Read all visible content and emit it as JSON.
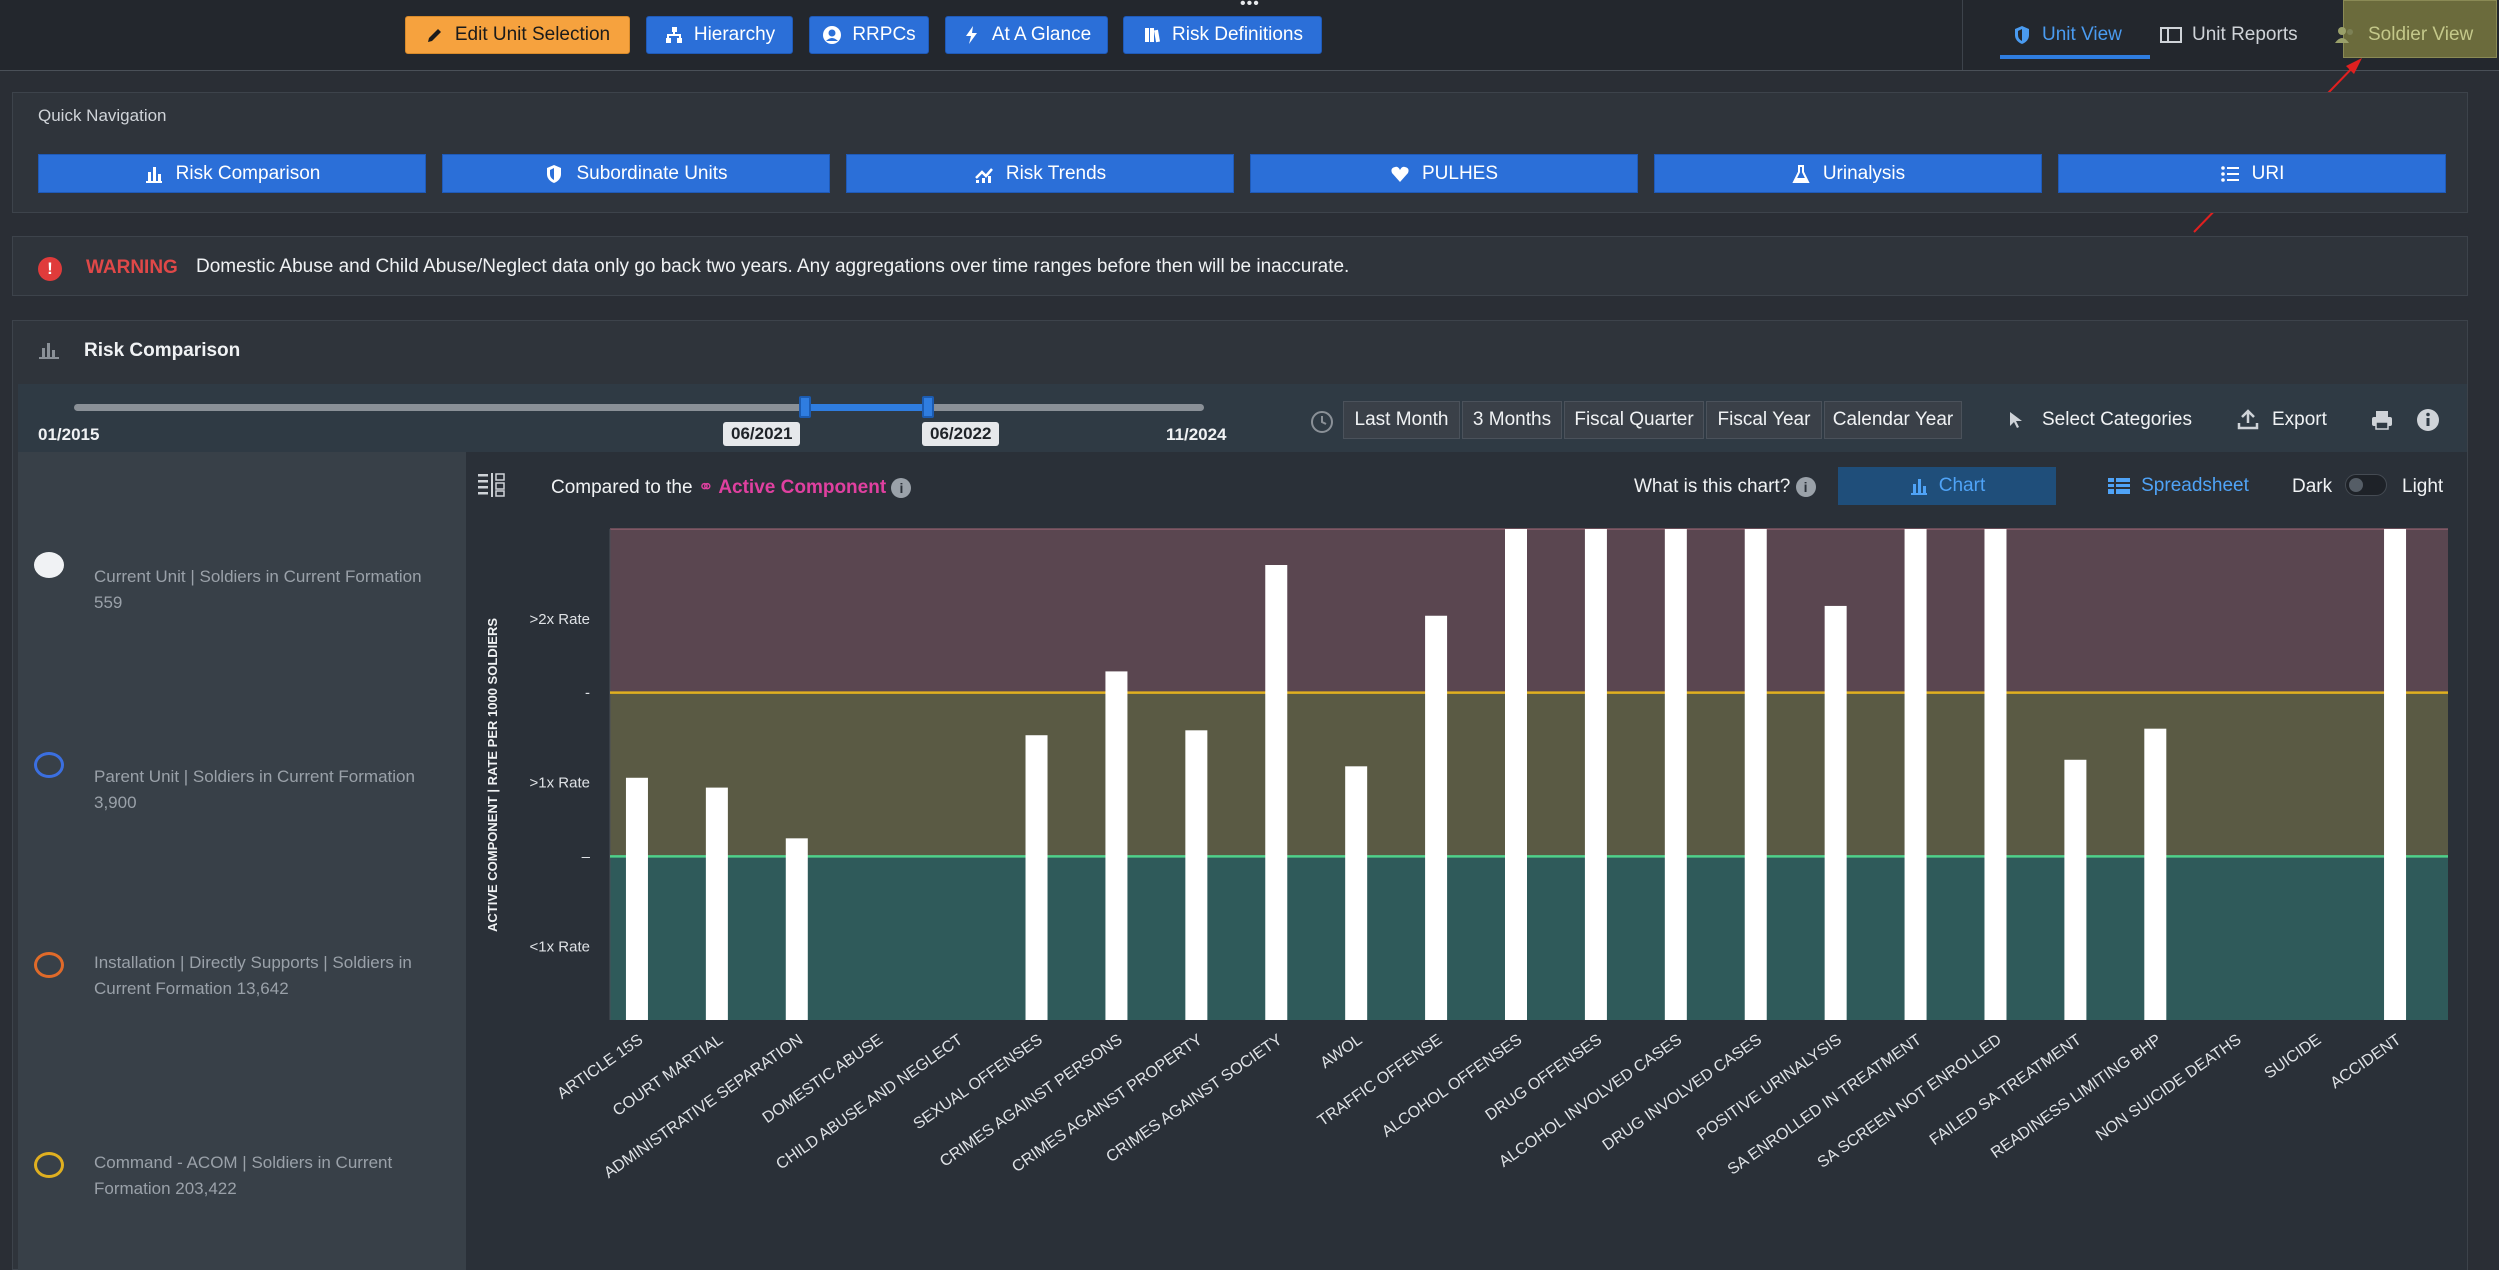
{
  "toolbar": {
    "buttons": [
      {
        "label": "Edit Unit Selection",
        "icon": "pencil-icon"
      },
      {
        "label": "Hierarchy",
        "icon": "hierarchy-icon"
      },
      {
        "label": "RRPCs",
        "icon": "user-circle-icon"
      },
      {
        "label": "At A Glance",
        "icon": "bolt-icon"
      },
      {
        "label": "Risk Definitions",
        "icon": "book-icon"
      }
    ],
    "views": [
      {
        "label": "Unit View",
        "icon": "shield-icon",
        "active": true
      },
      {
        "label": "Unit Reports",
        "icon": "report-icon",
        "active": false
      },
      {
        "label": "Soldier View",
        "icon": "soldiers-icon",
        "active": false
      }
    ]
  },
  "quick_nav": {
    "title": "Quick Navigation",
    "buttons": [
      {
        "label": "Risk Comparison",
        "icon": "bar-chart-icon"
      },
      {
        "label": "Subordinate Units",
        "icon": "shield-icon"
      },
      {
        "label": "Risk Trends",
        "icon": "trend-icon"
      },
      {
        "label": "PULHES",
        "icon": "heart-icon"
      },
      {
        "label": "Urinalysis",
        "icon": "flask-icon"
      },
      {
        "label": "URI",
        "icon": "list-icon"
      }
    ]
  },
  "warning": {
    "label": "WARNING",
    "text": "Domestic Abuse and Child Abuse/Neglect data only go back two years. Any aggregations over time ranges before then will be inaccurate."
  },
  "risk_comparison": {
    "title": "Risk Comparison",
    "date_range": {
      "start": "01/2015",
      "end": "11/2024",
      "selected_from": "06/2021",
      "selected_to": "06/2022",
      "selected_from_fraction": 0.64,
      "selected_to_fraction": 0.75
    },
    "range_buttons": [
      "Last Month",
      "3 Months",
      "Fiscal Quarter",
      "Fiscal Year",
      "Calendar Year"
    ],
    "tools": {
      "select_categories": "Select Categories",
      "export": "Export"
    },
    "compared_to_prefix": "Compared to the",
    "compared_to_value": "Active Component",
    "what_is_chart": "What is this chart?",
    "tabs": {
      "chart": "Chart",
      "spreadsheet": "Spreadsheet"
    },
    "theme": {
      "dark": "Dark",
      "light": "Light"
    },
    "legend": [
      {
        "line1": "Current Unit | Soldiers in Current Formation",
        "line2": "559",
        "color": "#f0f2f4",
        "filled": true
      },
      {
        "line1": "Parent Unit | Soldiers in Current Formation",
        "line2": "3,900",
        "color": "#3b6fe0",
        "filled": false
      },
      {
        "line1": "Installation | Directly Supports | Soldiers in",
        "line2": "Current Formation 13,642",
        "color": "#e06a2a",
        "filled": false
      },
      {
        "line1": "Command - ACOM | Soldiers in Current",
        "line2": "Formation 203,422",
        "color": "#e0b020",
        "filled": false
      }
    ]
  },
  "chart_data": {
    "type": "bar",
    "ylabel": "ACTIVE COMPONENT | RATE PER 1000 SOLDIERS",
    "y_tick_labels": [
      ">2x Rate",
      "-",
      ">1x Rate",
      "–",
      "<1x Rate"
    ],
    "ylim": [
      0,
      3
    ],
    "thresholds": [
      {
        "value": 1,
        "color": "#4fd08a"
      },
      {
        "value": 2,
        "color": "#e0b020"
      }
    ],
    "bands": [
      {
        "from": 0,
        "to": 1,
        "color": "#2f5a5a"
      },
      {
        "from": 1,
        "to": 2,
        "color": "#5a5a44"
      },
      {
        "from": 2,
        "to": 3,
        "color": "#5a4650"
      }
    ],
    "categories": [
      "ARTICLE 15S",
      "COURT MARTIAL",
      "ADMINISTRATIVE SEPARATION",
      "DOMESTIC ABUSE",
      "CHILD ABUSE AND NEGLECT",
      "SEXUAL OFFENSES",
      "CRIMES AGAINST PERSONS",
      "CRIMES AGAINST PROPERTY",
      "CRIMES AGAINST SOCIETY",
      "AWOL",
      "TRAFFIC OFFENSE",
      "ALCOHOL OFFENSES",
      "DRUG OFFENSES",
      "ALCOHOL INVOLVED CASES",
      "DRUG INVOLVED CASES",
      "POSITIVE URINALYSIS",
      "SA ENROLLED IN TREATMENT",
      "SA SCREEN NOT ENROLLED",
      "FAILED SA TREATMENT",
      "READINESS LIMITING BHP",
      "NON SUICIDE DEATHS",
      "SUICIDE",
      "ACCIDENT"
    ],
    "series": [
      {
        "name": "Current Unit",
        "color": "#ffffff",
        "values": [
          1.48,
          1.42,
          1.11,
          0,
          0,
          1.74,
          2.13,
          1.77,
          2.78,
          1.55,
          2.47,
          3,
          3,
          3,
          3,
          2.53,
          3,
          3,
          1.59,
          1.78,
          0,
          0,
          3
        ]
      }
    ]
  }
}
